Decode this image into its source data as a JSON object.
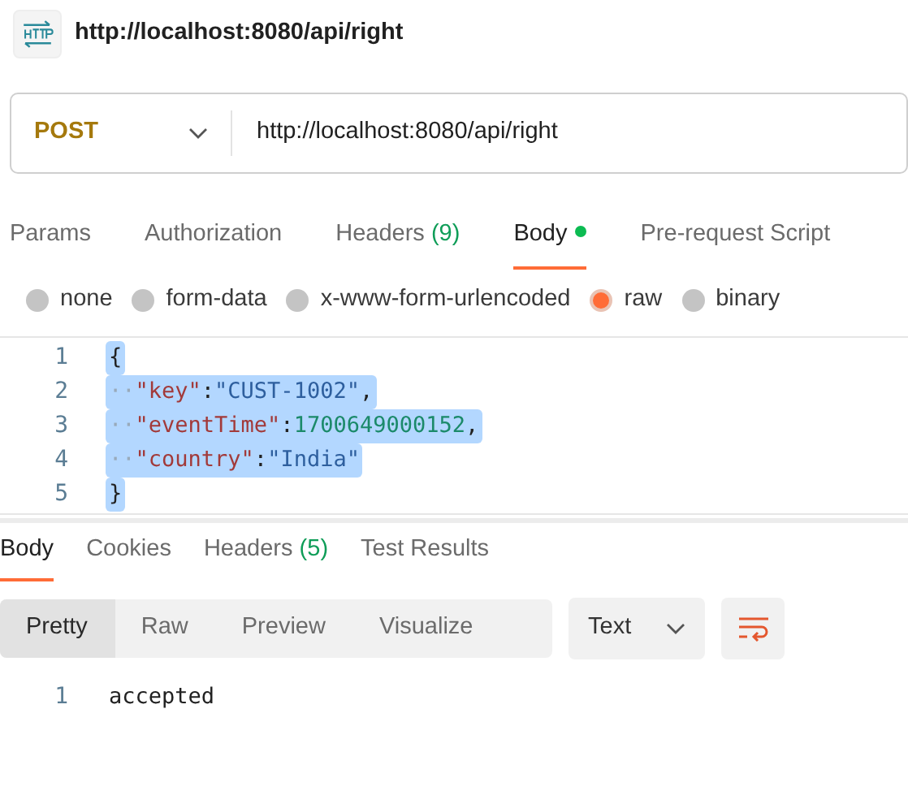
{
  "header": {
    "title": "http://localhost:8080/api/right"
  },
  "request": {
    "method": "POST",
    "url": "http://localhost:8080/api/right"
  },
  "request_tabs": [
    {
      "label": "Params",
      "selected": false
    },
    {
      "label": "Authorization",
      "selected": false
    },
    {
      "label": "Headers",
      "count": "(9)",
      "selected": false
    },
    {
      "label": "Body",
      "dot": true,
      "selected": true
    },
    {
      "label": "Pre-request Script",
      "selected": false
    }
  ],
  "body_types": [
    {
      "label": "none",
      "selected": false
    },
    {
      "label": "form-data",
      "selected": false
    },
    {
      "label": "x-www-form-urlencoded",
      "selected": false
    },
    {
      "label": "raw",
      "selected": true
    },
    {
      "label": "binary",
      "selected": false
    }
  ],
  "editor": {
    "lines": [
      {
        "number": "1",
        "selected": true,
        "tokens": [
          {
            "kind": "punct",
            "text": "{"
          }
        ]
      },
      {
        "number": "2",
        "selected": true,
        "tokens": [
          {
            "kind": "indent",
            "text": "··"
          },
          {
            "kind": "key",
            "text": "\"key\""
          },
          {
            "kind": "punct",
            "text": ":"
          },
          {
            "kind": "string",
            "text": "\"CUST-1002\""
          },
          {
            "kind": "punct",
            "text": ","
          }
        ]
      },
      {
        "number": "3",
        "selected": true,
        "tokens": [
          {
            "kind": "indent",
            "text": "··"
          },
          {
            "kind": "key",
            "text": "\"eventTime\""
          },
          {
            "kind": "punct",
            "text": ":"
          },
          {
            "kind": "number",
            "text": "1700649000152"
          },
          {
            "kind": "punct",
            "text": ","
          }
        ]
      },
      {
        "number": "4",
        "selected": true,
        "tokens": [
          {
            "kind": "indent",
            "text": "··"
          },
          {
            "kind": "key",
            "text": "\"country\""
          },
          {
            "kind": "punct",
            "text": ":"
          },
          {
            "kind": "string",
            "text": "\"India\""
          }
        ]
      },
      {
        "number": "5",
        "selected": true,
        "tokens": [
          {
            "kind": "punct",
            "text": "}"
          }
        ]
      }
    ]
  },
  "response_tabs": [
    {
      "label": "Body",
      "selected": true
    },
    {
      "label": "Cookies",
      "selected": false
    },
    {
      "label": "Headers",
      "count": "(5)",
      "selected": false
    },
    {
      "label": "Test Results",
      "selected": false
    }
  ],
  "view_modes": [
    {
      "label": "Pretty",
      "selected": true
    },
    {
      "label": "Raw",
      "selected": false
    },
    {
      "label": "Preview",
      "selected": false
    },
    {
      "label": "Visualize",
      "selected": false
    }
  ],
  "format": "Text",
  "response": {
    "lines": [
      {
        "number": "1",
        "text": "accepted"
      }
    ]
  }
}
